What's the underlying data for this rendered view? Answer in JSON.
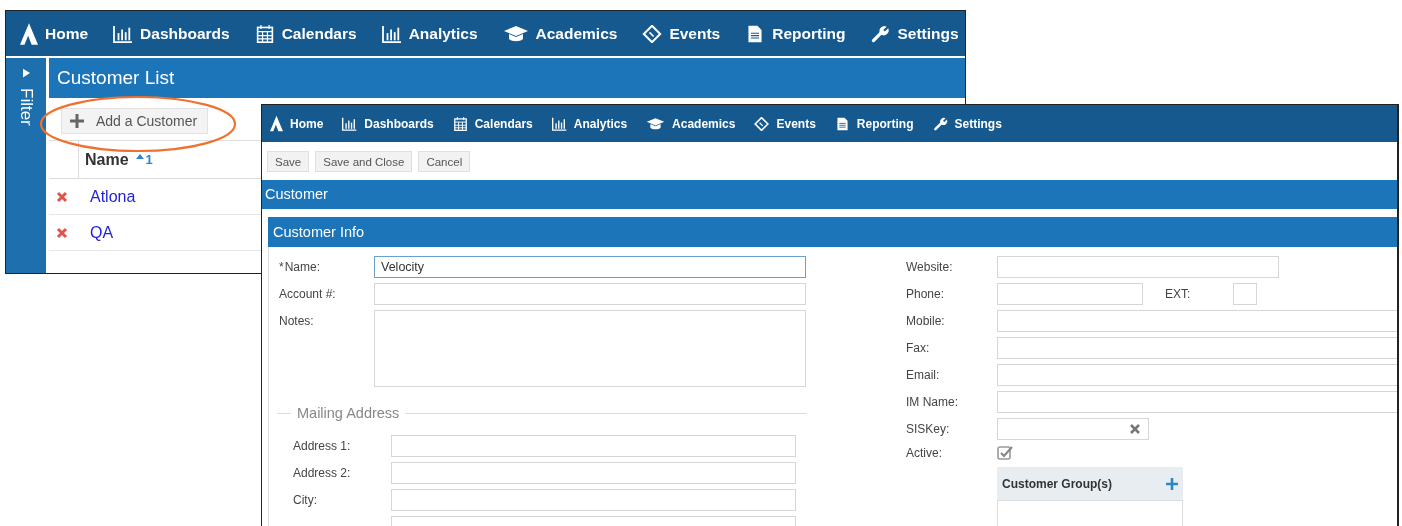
{
  "back_window": {
    "nav": [
      "Home",
      "Dashboards",
      "Calendars",
      "Analytics",
      "Academics",
      "Events",
      "Reporting",
      "Settings"
    ],
    "sidebar": {
      "label": "Filter"
    },
    "title": "Customer List",
    "add_button": "Add a Customer",
    "table": {
      "columns": [
        {
          "label": "Name",
          "sort": "1"
        }
      ],
      "rows": [
        {
          "name": "Atlona"
        },
        {
          "name": "QA"
        }
      ]
    }
  },
  "front_window": {
    "nav": [
      "Home",
      "Dashboards",
      "Calendars",
      "Analytics",
      "Academics",
      "Events",
      "Reporting",
      "Settings"
    ],
    "toolbar": [
      "Save",
      "Save and Close",
      "Cancel"
    ],
    "title": "Customer",
    "section": "Customer Info",
    "left_fields": [
      {
        "kind": "text",
        "label": "Name:",
        "required_mark": "*",
        "value": "Velocity",
        "focused": true
      },
      {
        "kind": "text",
        "label": "Account #:",
        "focused": false
      },
      {
        "kind": "textarea",
        "label": "Notes:",
        "focused": false
      }
    ],
    "mailing": {
      "legend": "Mailing Address",
      "fields": [
        {
          "label": "Address 1:"
        },
        {
          "label": "Address 2:"
        },
        {
          "label": "City:"
        }
      ]
    },
    "right_fields": [
      {
        "kind": "medium",
        "label": "Website:"
      },
      {
        "kind": "phone",
        "label": "Phone:",
        "ext_label": "EXT:"
      },
      {
        "kind": "wide",
        "label": "Mobile:"
      },
      {
        "kind": "wide",
        "label": "Fax:"
      },
      {
        "kind": "wide",
        "label": "Email:"
      },
      {
        "kind": "wide",
        "label": "IM Name:"
      },
      {
        "kind": "clearable",
        "label": "SISKey:"
      },
      {
        "kind": "checkbox",
        "label": "Active:",
        "checked": true
      }
    ],
    "groups_panel": {
      "title": "Customer Group(s)"
    }
  }
}
